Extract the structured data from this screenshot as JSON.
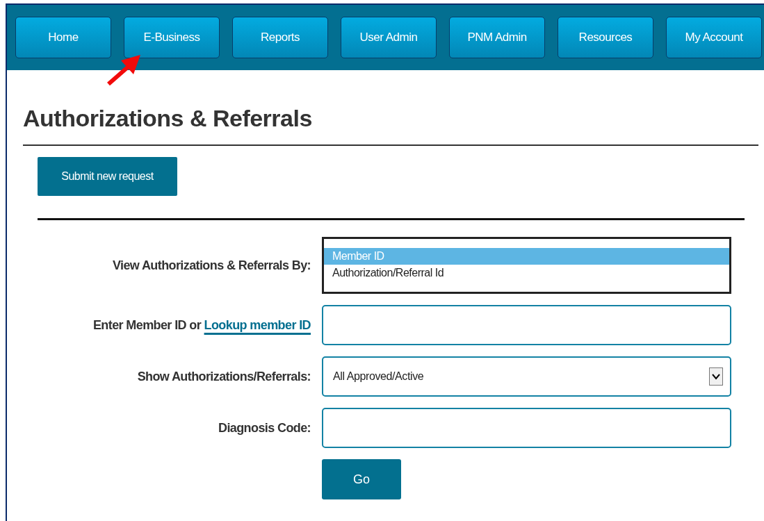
{
  "nav": [
    {
      "label": "Home"
    },
    {
      "label": "E-Business"
    },
    {
      "label": "Reports"
    },
    {
      "label": "User Admin"
    },
    {
      "label": "PNM Admin"
    },
    {
      "label": "Resources"
    },
    {
      "label": "My Account"
    }
  ],
  "title": "Authorizations & Referrals",
  "submit_button": "Submit new request",
  "form": {
    "view_by": {
      "label": "View Authorizations & Referrals By:",
      "options": [
        {
          "label": "Member ID",
          "selected": true
        },
        {
          "label": "Authorization/Referral Id",
          "selected": false
        }
      ]
    },
    "member_id": {
      "label": "Enter Member ID or",
      "link": "Lookup member ID"
    },
    "show": {
      "label": "Show Authorizations/Referrals:",
      "value": "All Approved/Active"
    },
    "diagnosis": {
      "label": "Diagnosis Code:"
    },
    "go_button": "Go"
  }
}
